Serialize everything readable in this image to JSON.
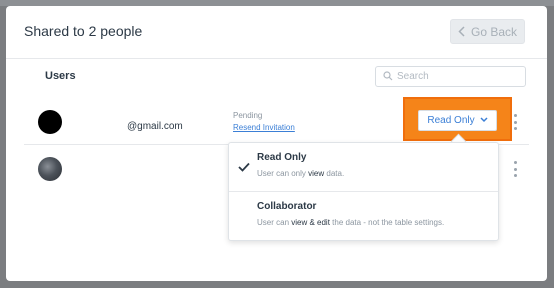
{
  "modal": {
    "title": "Shared to 2 people",
    "go_back_label": "Go Back"
  },
  "users_header": "Users",
  "search": {
    "placeholder": "Search"
  },
  "rows": [
    {
      "email": "@gmail.com",
      "status": "Pending",
      "action_link": "Resend Invitation",
      "role": "Read Only"
    },
    {
      "email": "",
      "status": "",
      "action_link": "",
      "role": ""
    }
  ],
  "role_dropdown": {
    "options": [
      {
        "label": "Read Only",
        "selected": true,
        "desc_pre": "User can only ",
        "desc_em": "view",
        "desc_post": " data."
      },
      {
        "label": "Collaborator",
        "selected": false,
        "desc_pre": "User can ",
        "desc_em": "view & edit",
        "desc_post": " the data - not the table settings."
      }
    ]
  },
  "colors": {
    "accent_link": "#3b7fd6",
    "highlight": "#f58419",
    "backdrop": "#7b7d80"
  }
}
